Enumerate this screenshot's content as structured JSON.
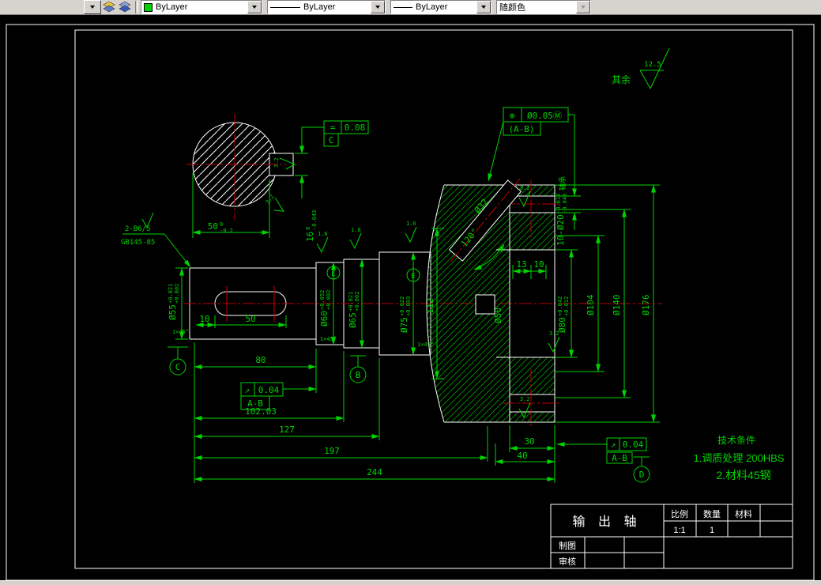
{
  "toolbar": {
    "color": "ByLayer",
    "linetype": "ByLayer",
    "lineweight": "ByLayer",
    "plotstyle": "随颜色"
  },
  "canvas": {
    "surface_default": {
      "prefix": "其余",
      "value": "12.5"
    },
    "center_hole_note": {
      "line1": "2-B6/5",
      "line2": "GB145-85"
    },
    "frames": {
      "f1": {
        "symbol": "=",
        "value": "0.08",
        "datum": "C"
      },
      "f2": {
        "symbol": "⊕",
        "value": "Ø0.05Ⓜ",
        "datum": "(A-B)"
      },
      "f3": {
        "symbol": "↗",
        "value": "0.04",
        "datum": "A-B"
      },
      "f4": {
        "symbol": "↗",
        "value": "0.04",
        "datum": "A-B"
      }
    },
    "datums": {
      "b": "B",
      "c": "C",
      "d": "D",
      "e1": "E",
      "e2": "E"
    },
    "diameters": {
      "d55": {
        "v": "Ø55",
        "sup": "+0.021",
        "sub": "+0.002"
      },
      "d60": {
        "v": "Ø60",
        "sup": "+0.052",
        "sub": "+0.002"
      },
      "d65": {
        "v": "Ø65",
        "sup": "+0.021",
        "sub": "+0.002"
      },
      "d75": {
        "v": "Ø75",
        "sup": "+0.022",
        "sub": "+0.003"
      },
      "d80": {
        "v": "Ø80",
        "sup": "+0.042",
        "sub": "+0.012"
      },
      "d104": "Ø104",
      "d140": "Ø140",
      "d176": "Ø176",
      "d50": "Ø50",
      "d32": "Ø32"
    },
    "linear_dims": {
      "k10": "10",
      "k50": "50",
      "w80": "80",
      "w10203": "102.03",
      "w127": "127",
      "w197": "197",
      "w244": "244",
      "w30": "30",
      "w40": "40",
      "w13": "13",
      "w10": "10",
      "h112": "112",
      "w50": {
        "v": "50",
        "sup": "0",
        "sub": "-0.2"
      },
      "h16": {
        "v": "16",
        "sup": "0",
        "sub": "-0.043"
      }
    },
    "holes": {
      "v": "10-Ø20",
      "sup": "-0.013",
      "sub": "-0.043",
      "suffix": "轴承"
    },
    "angle": "120°",
    "chamfer": "1×45°",
    "roughness": {
      "r32": "3.2",
      "r16": "1.6"
    },
    "tech": {
      "title": "技术条件",
      "line1": "1.调质处理  200HBS",
      "line2": "2.材料45钢"
    },
    "title_block": {
      "part": "输 出 轴",
      "scale_label": "比例",
      "qty_label": "数量",
      "mat_label": "材料",
      "scale": "1:1",
      "qty": "1",
      "draw_label": "制图",
      "check_label": "审核"
    }
  }
}
